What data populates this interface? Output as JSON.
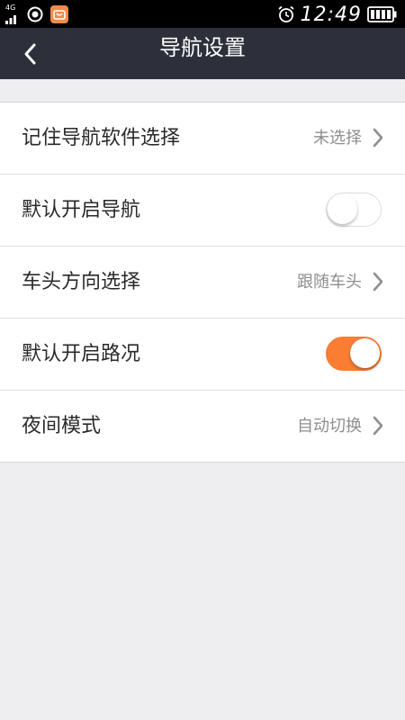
{
  "status_bar": {
    "network_label": "4G",
    "time": "12:49",
    "icons": [
      "signal-icon",
      "location-icon",
      "app-notification-icon",
      "alarm-clock-icon",
      "battery-icon"
    ]
  },
  "header": {
    "title": "导航设置",
    "back_icon": "chevron-left-icon"
  },
  "settings": {
    "items": [
      {
        "label": "记住导航软件选择",
        "value": "未选择",
        "control": "chevron"
      },
      {
        "label": "默认开启导航",
        "control": "toggle",
        "state": "off"
      },
      {
        "label": "车头方向选择",
        "value": "跟随车头",
        "control": "chevron"
      },
      {
        "label": "默认开启路况",
        "control": "toggle",
        "state": "on"
      },
      {
        "label": "夜间模式",
        "value": "自动切换",
        "control": "chevron"
      }
    ]
  },
  "colors": {
    "nav_background": "#2d2f3a",
    "toggle_on": "#f97d33",
    "page_background": "#eeeef0"
  }
}
